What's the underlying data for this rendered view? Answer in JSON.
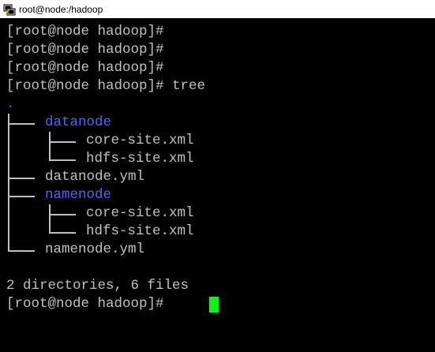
{
  "window": {
    "title": "root@node:/hadoop",
    "icon": "putty-terminal-icon"
  },
  "terminal": {
    "prompt_lines": [
      "[root@node hadoop]#",
      "[root@node hadoop]#",
      "[root@node hadoop]#",
      "[root@node hadoop]# tree"
    ],
    "tree_root": ".",
    "tree": [
      {
        "name": "datanode",
        "type": "directory",
        "children": [
          {
            "name": "core-site.xml",
            "type": "file"
          },
          {
            "name": "hdfs-site.xml",
            "type": "file"
          }
        ]
      },
      {
        "name": "datanode.yml",
        "type": "file"
      },
      {
        "name": "namenode",
        "type": "directory",
        "children": [
          {
            "name": "core-site.xml",
            "type": "file"
          },
          {
            "name": "hdfs-site.xml",
            "type": "file"
          }
        ]
      },
      {
        "name": "namenode.yml",
        "type": "file"
      }
    ],
    "summary": "2 directories, 6 files",
    "final_prompt": "[root@node hadoop]# ",
    "colors": {
      "background": "#000000",
      "text": "#c0c0c0",
      "directory": "#5c5cff",
      "cursor": "#00ff00"
    }
  }
}
